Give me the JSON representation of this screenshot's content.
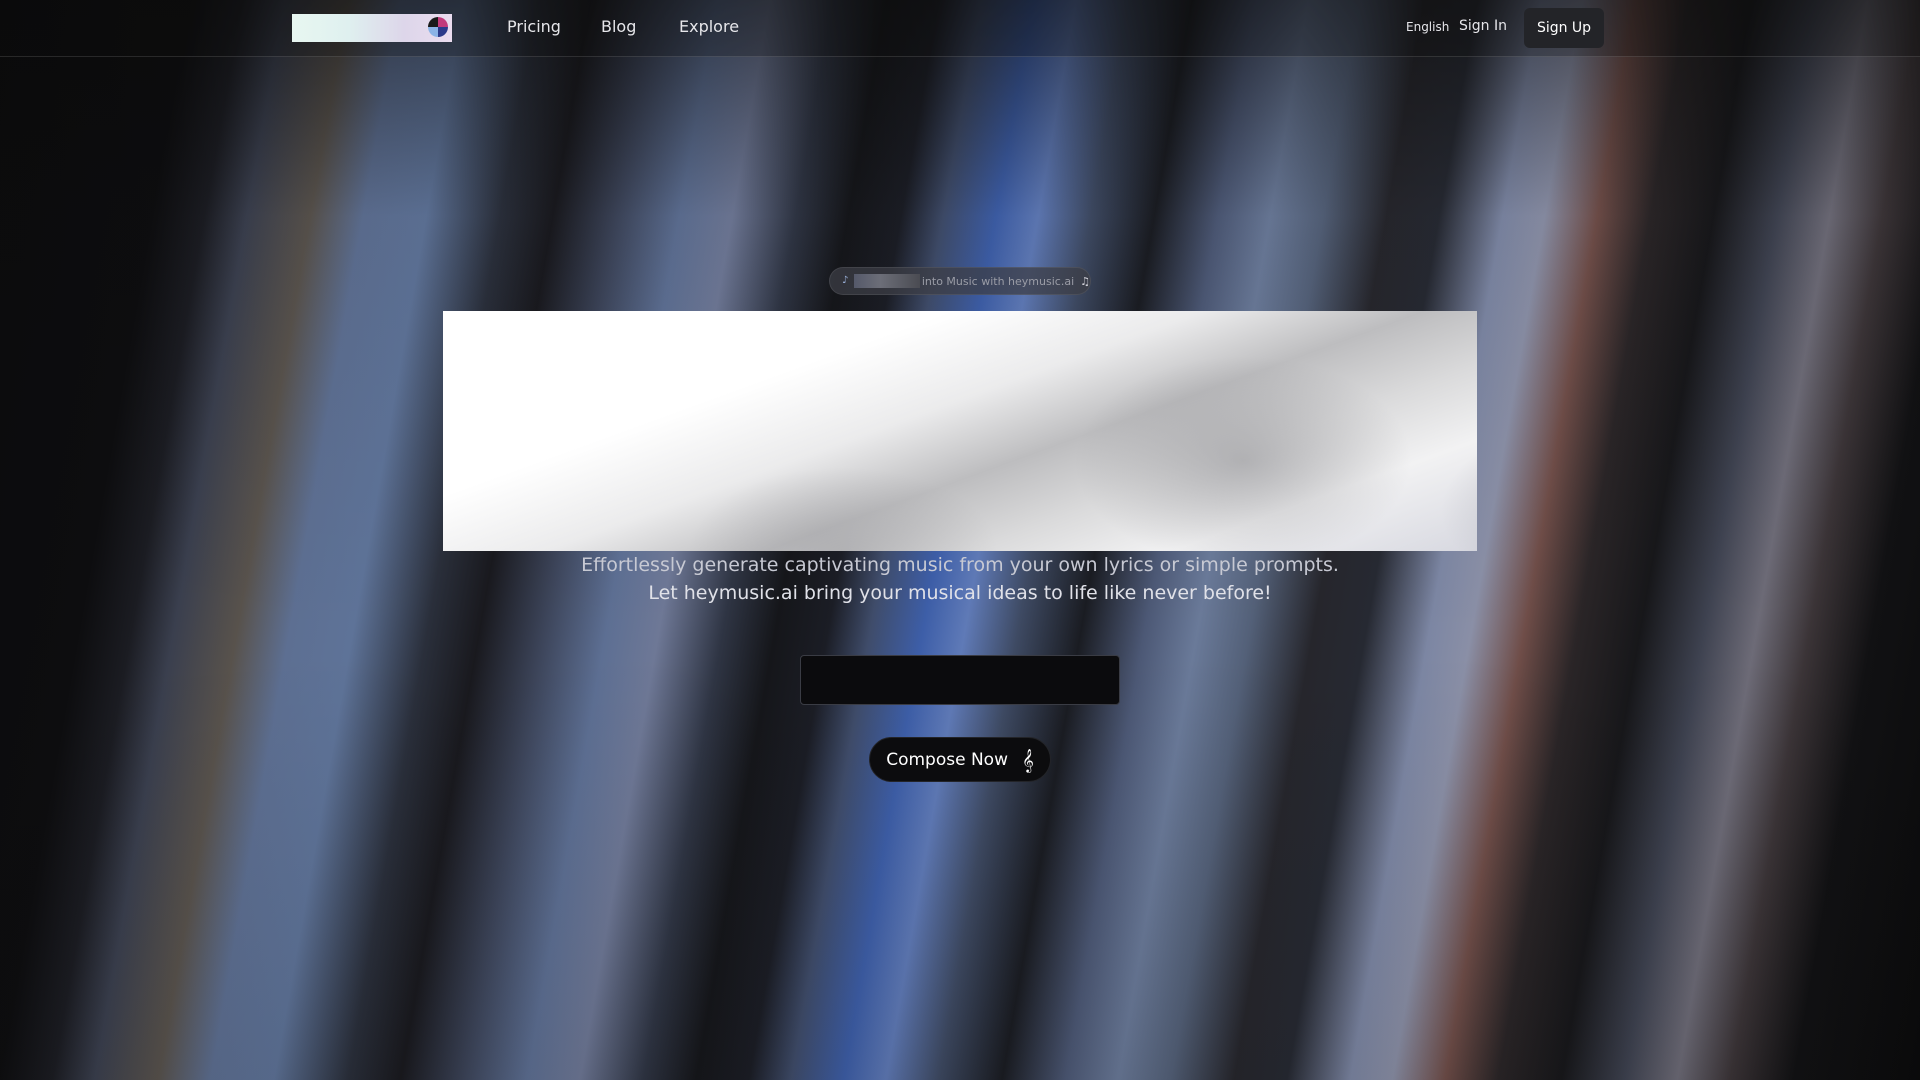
{
  "nav": {
    "links": [
      {
        "label": "Pricing"
      },
      {
        "label": "Blog"
      },
      {
        "label": "Explore"
      }
    ],
    "language": "English",
    "sign_in": "Sign In",
    "sign_up": "Sign Up"
  },
  "badge": {
    "text": "into Music with heymusic.ai",
    "icon_left": "music-note-icon",
    "icon_right": "music-notes-icon"
  },
  "hero": {
    "subtitle_line1": "Effortlessly generate captivating music from your own lyrics or simple prompts.",
    "subtitle_line2": "Let heymusic.ai bring your musical ideas to life like never before!"
  },
  "prompt": {
    "value": "",
    "placeholder": ""
  },
  "compose": {
    "label": "Compose Now",
    "icon": "treble-clef-icon"
  },
  "colors": {
    "background": "#0a0a0a",
    "signup_button": "#232428",
    "accent_blue": "#3d5ea8"
  }
}
